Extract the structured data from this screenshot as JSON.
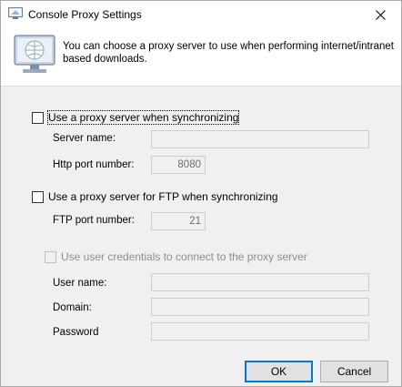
{
  "window": {
    "title": "Console Proxy Settings"
  },
  "header": {
    "description": "You can choose a proxy server to use when performing internet/intranet based downloads."
  },
  "proxy_sync": {
    "checkbox_label": "Use a proxy server when synchronizing",
    "checked": false,
    "server_name_label": "Server name:",
    "server_name_value": "",
    "http_port_label": "Http port number:",
    "http_port_value": "8080"
  },
  "proxy_ftp": {
    "checkbox_label": "Use a proxy server for FTP when synchronizing",
    "checked": false,
    "ftp_port_label": "FTP port number:",
    "ftp_port_value": "21"
  },
  "credentials": {
    "checkbox_label": "Use user credentials to connect to the proxy server",
    "checked": false,
    "username_label": "User name:",
    "username_value": "",
    "domain_label": "Domain:",
    "domain_value": "",
    "password_label": "Password",
    "password_value": ""
  },
  "buttons": {
    "ok": "OK",
    "cancel": "Cancel"
  },
  "colors": {
    "accent": "#0078d7",
    "disabled_text": "#8d8d8d"
  }
}
